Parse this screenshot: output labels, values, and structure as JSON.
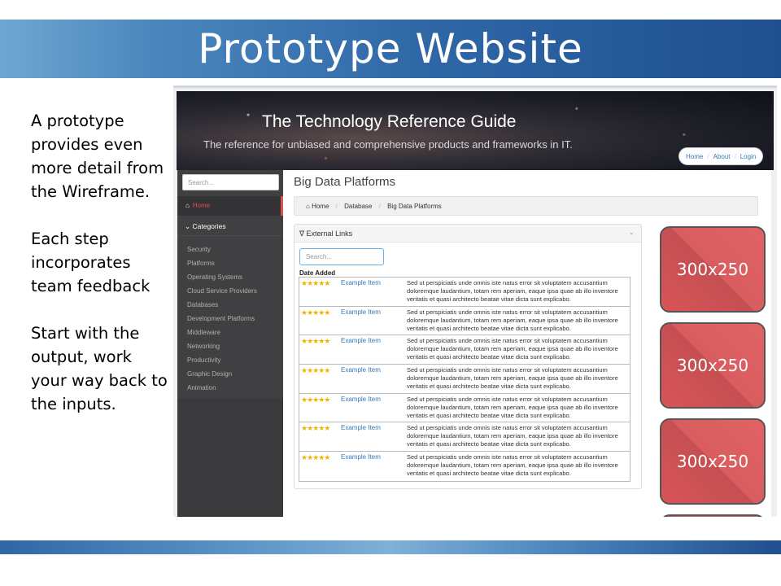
{
  "slide": {
    "title": "Prototype Website",
    "bullets": [
      "A prototype provides even more detail from the Wireframe.",
      "Each step incorporates team feedback",
      "Start with the output, work your way back to the inputs."
    ]
  },
  "site": {
    "title": "The Technology Reference Guide",
    "subtitle": "The reference for unbiased and comprehensive products and frameworks in IT.",
    "nav": [
      "Home",
      "About",
      "Login"
    ]
  },
  "sidebar": {
    "search_placeholder": "Search...",
    "home_label": "Home",
    "categories_label": "Categories",
    "items": [
      "Security",
      "Platforms",
      "Operating Systems",
      "Cloud Service Providers",
      "Databases",
      "Development Platforms",
      "Middleware",
      "Networking",
      "Productivity",
      "Graphic Design",
      "Animation"
    ]
  },
  "main": {
    "page_title": "Big Data Platforms",
    "breadcrumb": [
      "Home",
      "Database",
      "Big Data Platforms"
    ],
    "panel": {
      "title": "External Links",
      "search_placeholder": "Search...",
      "column_header": "Date Added",
      "rating": "★★★★★",
      "rows": [
        {
          "item": "Example Item",
          "desc": "Sed ut perspiciatis unde omnis iste natus error sit voluptatem accusantium doloremque laudantium, totam rem aperiam, eaque ipsa quae ab illo inventore veritatis et quasi architecto beatae vitae dicta sunt explicabo."
        },
        {
          "item": "Example Item",
          "desc": "Sed ut perspiciatis unde omnis iste natus error sit voluptatem accusantium doloremque laudantium, totam rem aperiam, eaque ipsa quae ab illo inventore veritatis et quasi architecto beatae vitae dicta sunt explicabo."
        },
        {
          "item": "Example Item",
          "desc": "Sed ut perspiciatis unde omnis iste natus error sit voluptatem accusantium doloremque laudantium, totam rem aperiam, eaque ipsa quae ab illo inventore veritatis et quasi architecto beatae vitae dicta sunt explicabo."
        },
        {
          "item": "Example Item",
          "desc": "Sed ut perspiciatis unde omnis iste natus error sit voluptatem accusantium doloremque laudantium, totam rem aperiam, eaque ipsa quae ab illo inventore veritatis et quasi architecto beatae vitae dicta sunt explicabo."
        },
        {
          "item": "Example Item",
          "desc": "Sed ut perspiciatis unde omnis iste natus error sit voluptatem accusantium doloremque laudantium, totam rem aperiam, eaque ipsa quae ab illo inventore veritatis et quasi architecto beatae vitae dicta sunt explicabo."
        },
        {
          "item": "Example Item",
          "desc": "Sed ut perspiciatis unde omnis iste natus error sit voluptatem accusantium doloremque laudantium, totam rem aperiam, eaque ipsa quae ab illo inventore veritatis et quasi architecto beatae vitae dicta sunt explicabo."
        },
        {
          "item": "Example Item",
          "desc": "Sed ut perspiciatis unde omnis iste natus error sit voluptatem accusantium doloremque laudantium, totam rem aperiam, eaque ipsa quae ab illo inventore veritatis et quasi architecto beatae vitae dicta sunt explicabo."
        }
      ]
    },
    "ads": [
      "300x250",
      "300x250",
      "300x250"
    ]
  },
  "colors": {
    "accent_red": "#d9534f",
    "link_blue": "#337ab7",
    "sidebar_bg": "#404042",
    "star_gold": "#f0b400"
  }
}
